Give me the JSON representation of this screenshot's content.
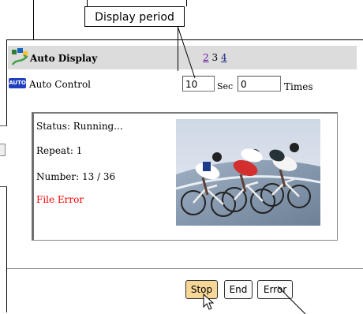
{
  "callout": {
    "label": "Display period"
  },
  "header": {
    "title": "Auto Display",
    "pages": [
      "2",
      "3",
      "4"
    ]
  },
  "auto_control": {
    "label": "Auto Control",
    "icon_text": "AUTO",
    "period_value": "10",
    "period_unit": "Sec",
    "repeat_value": "0",
    "repeat_unit": "Times"
  },
  "status": {
    "status_line": "Status:  Running...",
    "repeat_line": "Repeat:  1",
    "number_line": "Number:  13 / 36",
    "error_line": "File Error",
    "error_color": "#ff0000"
  },
  "buttons": {
    "stop": "Stop",
    "end": "End",
    "error": "Error"
  },
  "icons": {
    "header_icon": "auto-display-icon",
    "auto_icon": "auto-control-icon",
    "cursor": "mouse-pointer-icon"
  }
}
